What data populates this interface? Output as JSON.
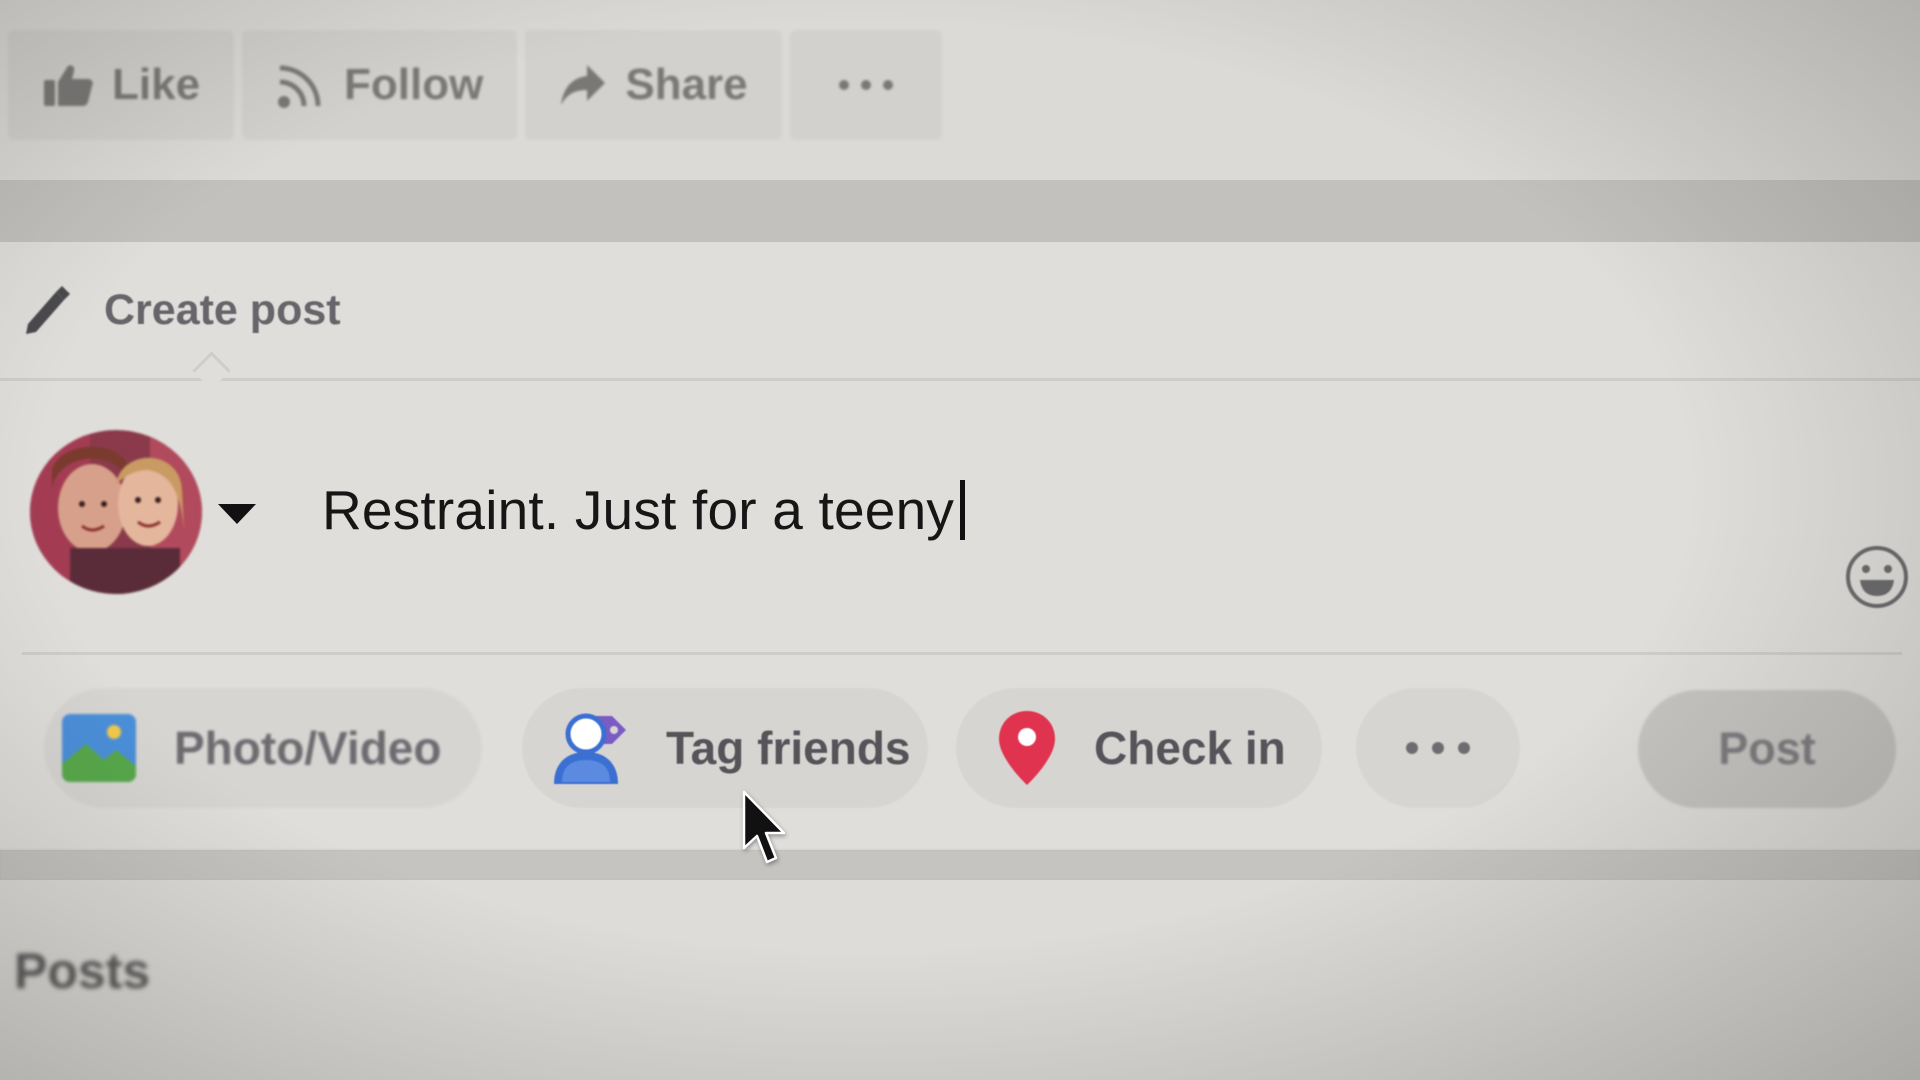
{
  "top_actions": [
    {
      "label": "Like",
      "icon": "thumbs-up-icon"
    },
    {
      "label": "Follow",
      "icon": "rss-icon"
    },
    {
      "label": "Share",
      "icon": "share-arrow-icon"
    },
    {
      "label": "",
      "icon": "more-dots-icon"
    }
  ],
  "composer": {
    "title": "Create post",
    "title_icon": "pencil-icon",
    "input_text": "Restraint. Just for a teeny",
    "emoji_icon": "smiley-icon",
    "actions": [
      {
        "label": "Photo/Video",
        "icon": "photo-icon"
      },
      {
        "label": "Tag friends",
        "icon": "tag-friends-icon"
      },
      {
        "label": "Check in",
        "icon": "location-pin-icon"
      },
      {
        "label": "",
        "icon": "more-dots-icon"
      }
    ],
    "post_button": "Post"
  },
  "posts_section": {
    "title": "Posts"
  },
  "colors": {
    "photo_icon_blue": "#4a8fd9",
    "photo_icon_green": "#57a84a",
    "tag_icon_blue": "#3b6fd1",
    "tag_icon_purple": "#7b5cc4",
    "pin_red": "#e0334f",
    "input_text": "#161616"
  }
}
